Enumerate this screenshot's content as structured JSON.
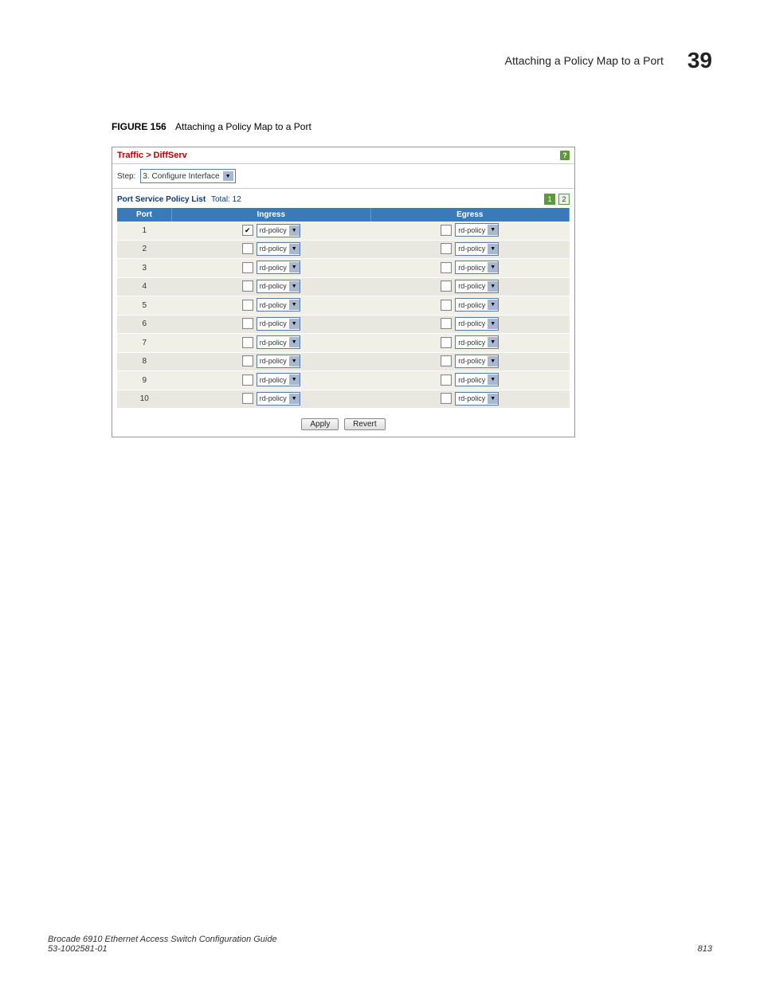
{
  "header": {
    "title": "Attaching a Policy Map to a Port",
    "chapter": "39"
  },
  "figure": {
    "label": "FIGURE 156",
    "caption": "Attaching a Policy Map to a Port"
  },
  "breadcrumb": "Traffic > DiffServ",
  "step": {
    "label": "Step:",
    "value": "3. Configure Interface"
  },
  "list": {
    "title": "Port Service Policy List",
    "total_label": "Total:",
    "total": "12",
    "pages": [
      "1",
      "2"
    ],
    "active_page": "1"
  },
  "columns": {
    "port": "Port",
    "ingress": "Ingress",
    "egress": "Egress"
  },
  "policy_option": "rd-policy",
  "rows": [
    {
      "port": "1",
      "ingress_checked": true,
      "egress_checked": false
    },
    {
      "port": "2",
      "ingress_checked": false,
      "egress_checked": false
    },
    {
      "port": "3",
      "ingress_checked": false,
      "egress_checked": false
    },
    {
      "port": "4",
      "ingress_checked": false,
      "egress_checked": false
    },
    {
      "port": "5",
      "ingress_checked": false,
      "egress_checked": false
    },
    {
      "port": "6",
      "ingress_checked": false,
      "egress_checked": false
    },
    {
      "port": "7",
      "ingress_checked": false,
      "egress_checked": false
    },
    {
      "port": "8",
      "ingress_checked": false,
      "egress_checked": false
    },
    {
      "port": "9",
      "ingress_checked": false,
      "egress_checked": false
    },
    {
      "port": "10",
      "ingress_checked": false,
      "egress_checked": false
    }
  ],
  "buttons": {
    "apply": "Apply",
    "revert": "Revert"
  },
  "footer": {
    "left_line1": "Brocade 6910 Ethernet Access Switch Configuration Guide",
    "left_line2": "53-1002581-01",
    "page_number": "813"
  }
}
